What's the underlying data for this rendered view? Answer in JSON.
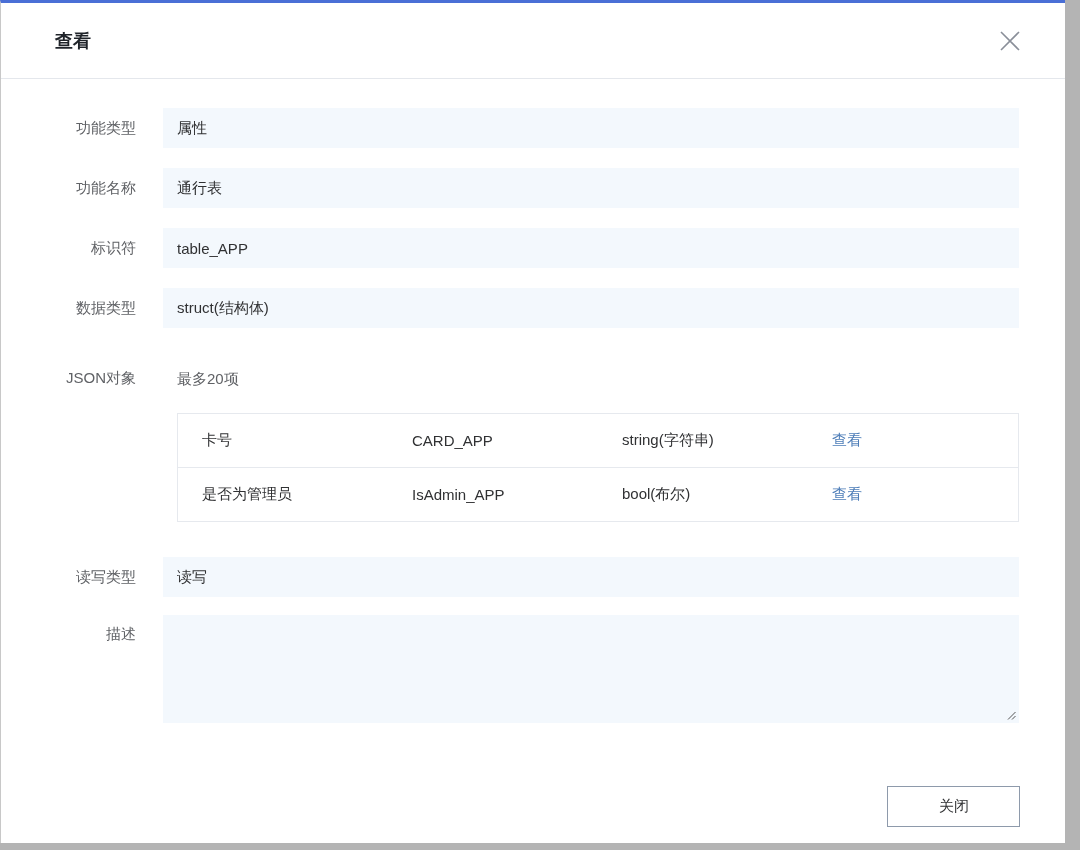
{
  "dialog": {
    "title": "查看",
    "form": [
      {
        "kind": "input",
        "label": "功能类型",
        "value": "属性"
      },
      {
        "kind": "input",
        "label": "功能名称",
        "value": "通行表"
      },
      {
        "kind": "input",
        "label": "标识符",
        "value": "table_APP"
      },
      {
        "kind": "input",
        "label": "数据类型",
        "value": "struct(结构体)"
      },
      {
        "kind": "object",
        "label": "JSON对象",
        "hint": "最多20项",
        "rows": [
          {
            "name": "卡号",
            "identifier": "CARD_APP",
            "data_type": "string(字符串)",
            "action": "查看"
          },
          {
            "name": "是否为管理员",
            "identifier": "IsAdmin_APP",
            "data_type": "bool(布尔)",
            "action": "查看"
          }
        ]
      },
      {
        "kind": "input",
        "label": "读写类型",
        "value": "读写"
      },
      {
        "kind": "textarea",
        "label": "描述"
      }
    ],
    "buttons": [
      "关闭"
    ]
  }
}
